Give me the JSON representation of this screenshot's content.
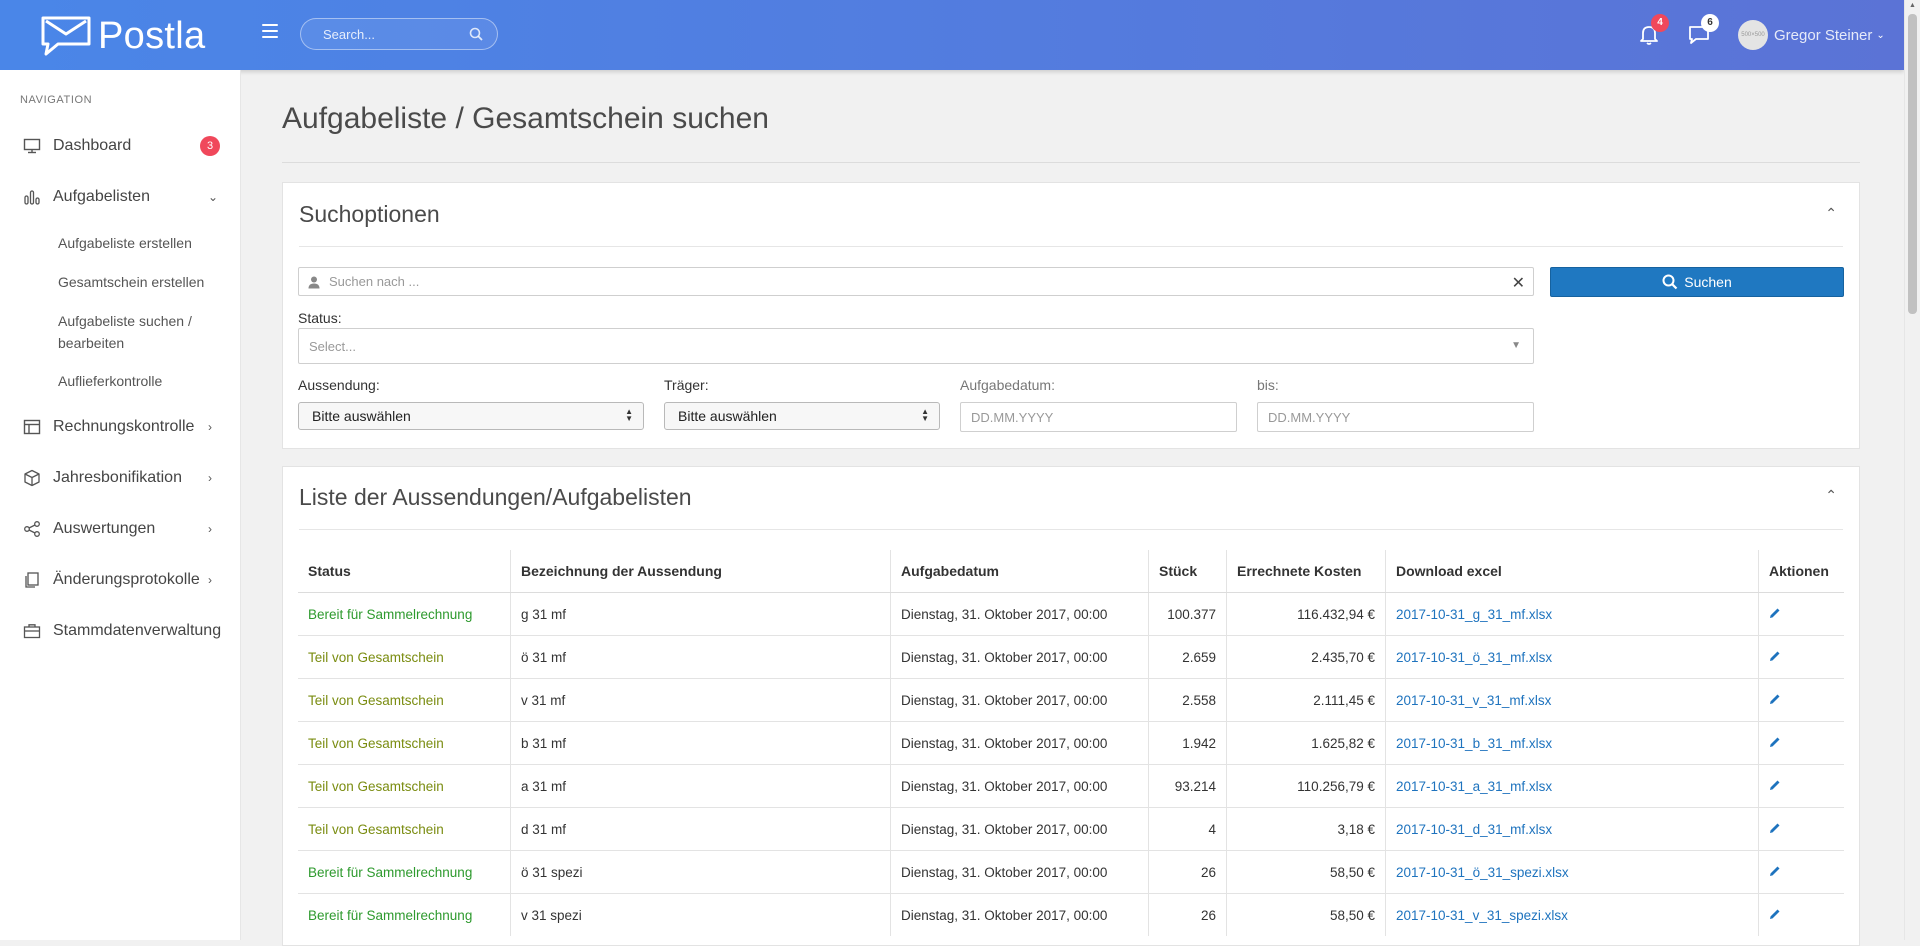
{
  "brand": {
    "name": "Postla"
  },
  "header": {
    "search_placeholder": "Search...",
    "notifications_count": "4",
    "messages_count": "6",
    "user_name": "Gregor Steiner",
    "avatar_text": "500×500"
  },
  "sidebar": {
    "heading": "NAVIGATION",
    "items": [
      {
        "label": "Dashboard",
        "icon": "monitor-icon",
        "badge": "3"
      },
      {
        "label": "Aufgabelisten",
        "icon": "bar-chart-icon"
      },
      {
        "label": "Rechnungskontrolle",
        "icon": "table-icon"
      },
      {
        "label": "Jahresbonifikation",
        "icon": "box-icon"
      },
      {
        "label": "Auswertungen",
        "icon": "share-icon"
      },
      {
        "label": "Änderungsprotokolle",
        "icon": "copy-icon"
      },
      {
        "label": "Stammdatenverwaltung",
        "icon": "briefcase-icon"
      }
    ],
    "subitems": [
      "Aufgabeliste erstellen",
      "Gesamtschein erstellen",
      "Aufgabeliste suchen / bearbeiten",
      "Auflieferkontrolle"
    ]
  },
  "page": {
    "title": "Aufgabeliste / Gesamtschein suchen"
  },
  "search_panel": {
    "title": "Suchoptionen",
    "query_placeholder": "Suchen nach ...",
    "search_button": "Suchen",
    "status_label": "Status:",
    "status_placeholder": "Select...",
    "aussendung_label": "Aussendung:",
    "aussendung_value": "Bitte auswählen",
    "traeger_label": "Träger:",
    "traeger_value": "Bitte auswählen",
    "aufgabedatum_label": "Aufgabedatum:",
    "aufgabedatum_placeholder": "DD.MM.YYYY",
    "bis_label": "bis:",
    "bis_placeholder": "DD.MM.YYYY"
  },
  "list_panel": {
    "title": "Liste der Aussendungen/Aufgabelisten",
    "columns": [
      "Status",
      "Bezeichnung der Aussendung",
      "Aufgabedatum",
      "Stück",
      "Errechnete Kosten",
      "Download excel",
      "Aktionen"
    ],
    "rows": [
      {
        "status": "Bereit für Sammelrechnung",
        "status_color": "#2e9a2e",
        "bezeichnung": "g 31 mf",
        "datum": "Dienstag, 31. Oktober 2017, 00:00",
        "stueck": "100.377",
        "kosten": "116.432,94 €",
        "file": "2017-10-31_g_31_mf.xlsx"
      },
      {
        "status": "Teil von Gesamtschein",
        "status_color": "#7a8c10",
        "bezeichnung": "ö 31 mf",
        "datum": "Dienstag, 31. Oktober 2017, 00:00",
        "stueck": "2.659",
        "kosten": "2.435,70 €",
        "file": "2017-10-31_ö_31_mf.xlsx"
      },
      {
        "status": "Teil von Gesamtschein",
        "status_color": "#7a8c10",
        "bezeichnung": "v 31 mf",
        "datum": "Dienstag, 31. Oktober 2017, 00:00",
        "stueck": "2.558",
        "kosten": "2.111,45 €",
        "file": "2017-10-31_v_31_mf.xlsx"
      },
      {
        "status": "Teil von Gesamtschein",
        "status_color": "#7a8c10",
        "bezeichnung": "b 31 mf",
        "datum": "Dienstag, 31. Oktober 2017, 00:00",
        "stueck": "1.942",
        "kosten": "1.625,82 €",
        "file": "2017-10-31_b_31_mf.xlsx"
      },
      {
        "status": "Teil von Gesamtschein",
        "status_color": "#7a8c10",
        "bezeichnung": "a 31 mf",
        "datum": "Dienstag, 31. Oktober 2017, 00:00",
        "stueck": "93.214",
        "kosten": "110.256,79 €",
        "file": "2017-10-31_a_31_mf.xlsx"
      },
      {
        "status": "Teil von Gesamtschein",
        "status_color": "#7a8c10",
        "bezeichnung": "d 31 mf",
        "datum": "Dienstag, 31. Oktober 2017, 00:00",
        "stueck": "4",
        "kosten": "3,18 €",
        "file": "2017-10-31_d_31_mf.xlsx"
      },
      {
        "status": "Bereit für Sammelrechnung",
        "status_color": "#2e9a2e",
        "bezeichnung": "ö 31 spezi",
        "datum": "Dienstag, 31. Oktober 2017, 00:00",
        "stueck": "26",
        "kosten": "58,50 €",
        "file": "2017-10-31_ö_31_spezi.xlsx"
      },
      {
        "status": "Bereit für Sammelrechnung",
        "status_color": "#2e9a2e",
        "bezeichnung": "v 31 spezi",
        "datum": "Dienstag, 31. Oktober 2017, 00:00",
        "stueck": "26",
        "kosten": "58,50 €",
        "file": "2017-10-31_v_31_spezi.xlsx"
      }
    ]
  }
}
